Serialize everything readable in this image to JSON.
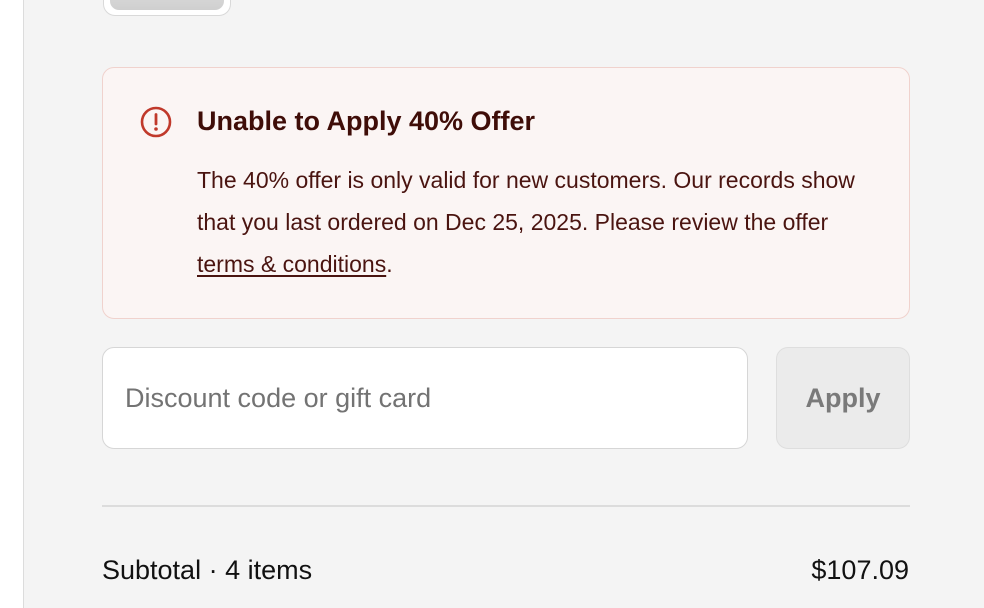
{
  "product": {
    "thumbnail_icon": "product-image"
  },
  "offer_alert": {
    "icon": "alert-circle-icon",
    "icon_color": "#c0392b",
    "title": "Unable to Apply 40% Offer",
    "message_before_link": "The 40% offer is only valid for new customers. Our records show that you last ordered on Dec 25, 2025. Please review the offer ",
    "link_label": "terms & conditions",
    "message_after_link": ".",
    "background_color": "#fbf5f4",
    "border_color": "#f0d2cd",
    "text_color": "#3f0d08"
  },
  "discount": {
    "placeholder": "Discount code or gift card",
    "value": "",
    "apply_label": "Apply"
  },
  "summary": {
    "subtotal_label": "Subtotal · 4 items",
    "subtotal_value": "$107.09"
  }
}
